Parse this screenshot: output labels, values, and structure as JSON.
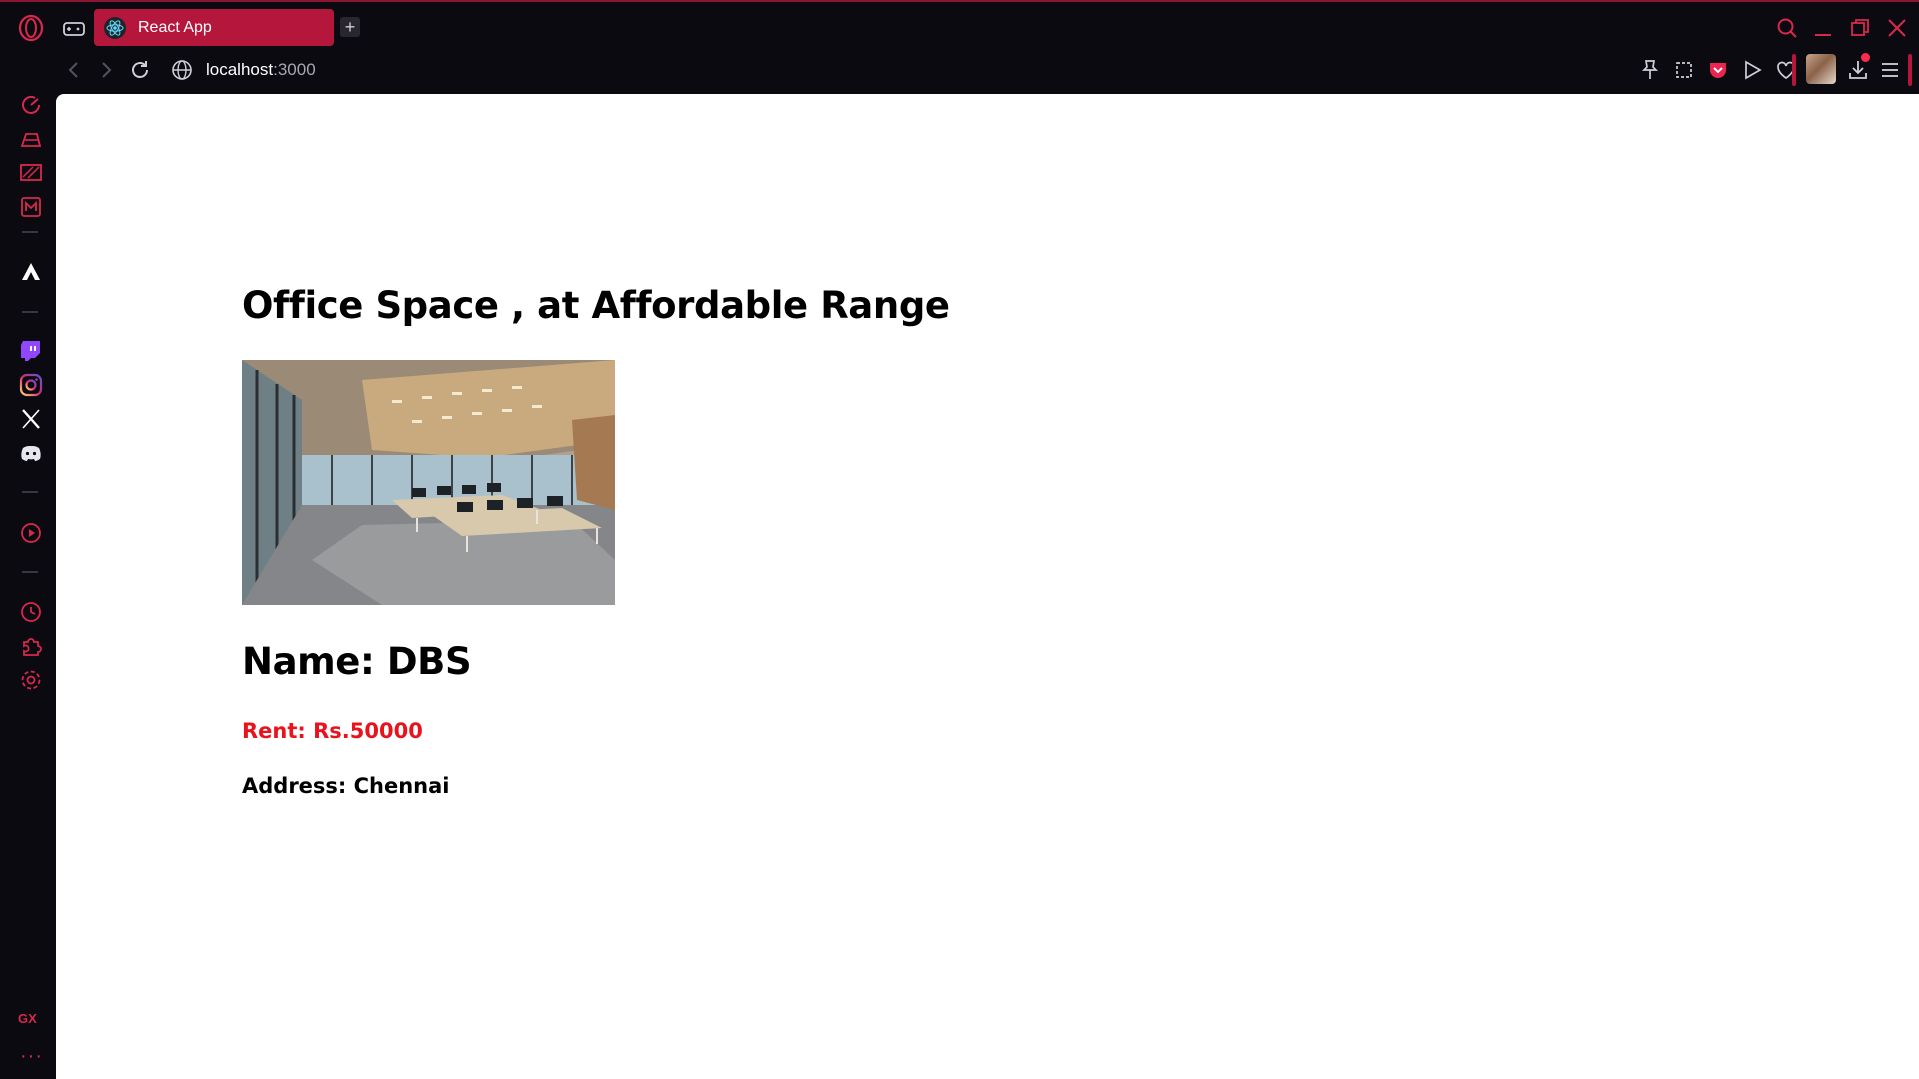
{
  "browser": {
    "tab": {
      "title": "React App",
      "favicon": "react-icon"
    },
    "new_tab_label": "+",
    "url": {
      "host": "localhost",
      "port": ":3000"
    },
    "accent_color": "#b5163b",
    "sidebar_bottom_label": "GX",
    "sidebar_more_label": "···"
  },
  "page": {
    "heading": "Office Space , at Affordable Range",
    "image": {
      "subject": "office-interior-photo"
    },
    "name_text": "Name: DBS",
    "rent_text": "Rent: Rs.50000",
    "rent_color": "#e8131c",
    "address_text": "Address: Chennai"
  }
}
